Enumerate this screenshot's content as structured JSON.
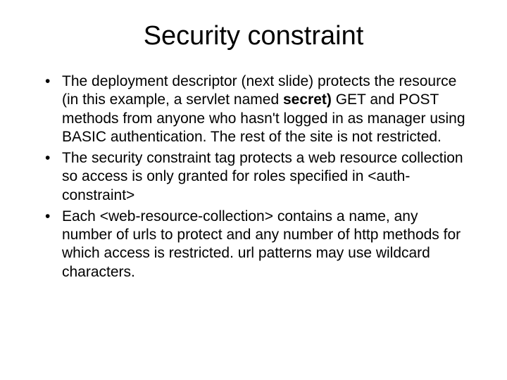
{
  "title": "Security constraint",
  "bullets": [
    {
      "pre": "The deployment descriptor (next slide) protects the resource (in this example, a servlet named ",
      "bold": "secret)",
      "post": " GET and POST methods from anyone who hasn't logged in as manager using BASIC authentication.  The rest of the site is not restricted."
    },
    {
      "pre": "The security constraint tag protects a web resource collection so access is only granted for roles specified in <auth-constraint>",
      "bold": "",
      "post": ""
    },
    {
      "pre": "Each <web-resource-collection> contains a name, any number of urls to protect and any number of http methods for which access is restricted. url patterns may use wildcard characters.",
      "bold": "",
      "post": ""
    }
  ]
}
